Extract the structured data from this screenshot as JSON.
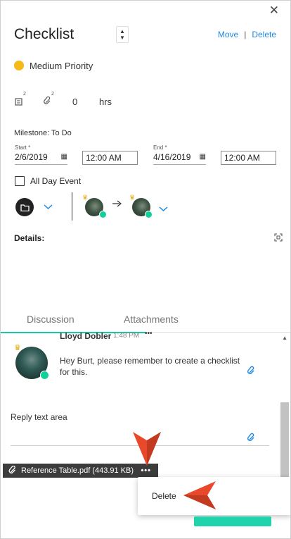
{
  "header": {
    "title": "Checklist",
    "move_label": "Move",
    "separator": "|",
    "delete_label": "Delete"
  },
  "priority": {
    "label": "Medium Priority",
    "color": "#f5b918"
  },
  "meta": {
    "notes_count": "2",
    "attachments_count": "2",
    "hours_value": "0",
    "hours_unit": "hrs"
  },
  "milestone": "Milestone: To Do",
  "dates": {
    "start_label": "Start *",
    "start_date": "2/6/2019",
    "start_time": "12:00 AM",
    "end_label": "End *",
    "end_date": "4/16/2019",
    "end_time": "12:00 AM"
  },
  "all_day_label": "All Day Event",
  "details_label": "Details:",
  "tabs": [
    {
      "label": "Discussion",
      "active": true
    },
    {
      "label": "Attachments",
      "active": false
    }
  ],
  "discussion": {
    "author": "Lloyd Dobler",
    "time": "1:48 PM",
    "more": "•••",
    "message": "Hey Burt, please remember to create a checklist for this.",
    "reply_placeholder": "Reply text area"
  },
  "attachment": {
    "name": "Reference Table.pdf (443.91 KB)",
    "more": "•••"
  },
  "context_menu": {
    "delete_label": "Delete"
  },
  "colors": {
    "accent": "#1e88e5",
    "teal": "#18c7a3",
    "online": "#10d19a",
    "callout": "#e8492a"
  },
  "icons": {
    "close": "✕",
    "folder": "folder-icon",
    "chevron": "chevron-down-icon",
    "arrow": "arrow-right-icon",
    "paperclip": "paperclip-icon",
    "calendar": "calendar-icon",
    "expand": "expand-icon"
  }
}
